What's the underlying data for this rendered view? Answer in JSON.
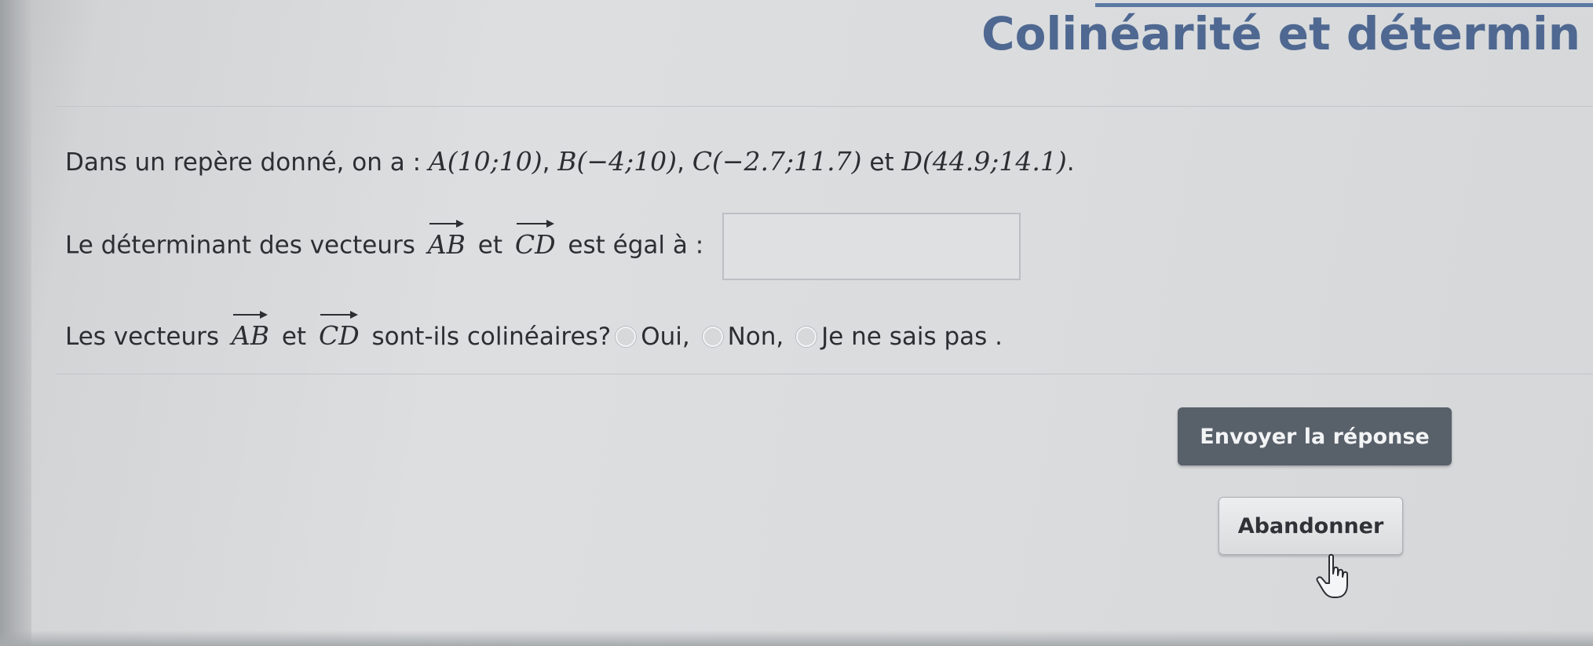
{
  "page": {
    "title": "Colinéarité et détermin"
  },
  "question": {
    "intro": "Dans un repère donné, on a : ",
    "point_a": "A(10;10)",
    "point_b": "B(−4;10)",
    "point_c": "C(−2.7;11.7)",
    "point_d": "D(44.9;14.1)",
    "sep": ", ",
    "et": " et ",
    "end": ".",
    "determinant_prefix": "Le déterminant des vecteurs",
    "vec_ab": "AB",
    "vec_cd": "CD",
    "et_word": "et",
    "determinant_suffix": "est égal à :",
    "determinant_value": "",
    "colinear_prefix": "Les vecteurs",
    "colinear_suffix": "sont-ils colinéaires?",
    "options": [
      "Oui,",
      "Non,",
      "Je ne sais pas ."
    ]
  },
  "buttons": {
    "submit": "Envoyer la réponse",
    "abandon": "Abandonner"
  },
  "colors": {
    "title": "#4f6891",
    "submit_bg": "#58606a"
  },
  "icons": {
    "cursor": "hand-pointer-icon"
  }
}
